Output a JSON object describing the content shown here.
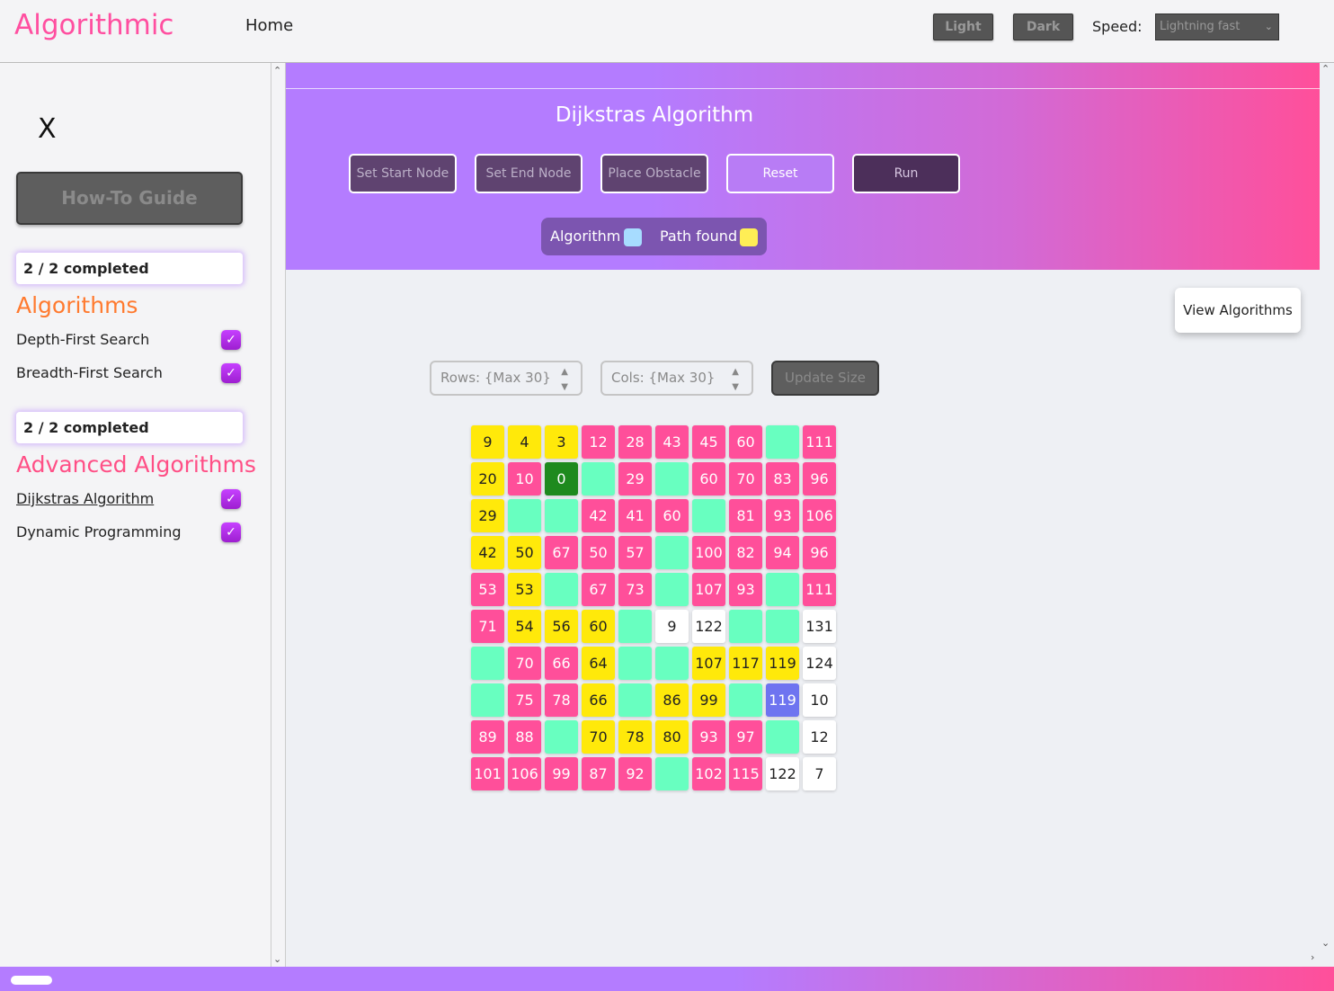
{
  "nav": {
    "brand": "Algorithmic",
    "home": "Home",
    "light": "Light",
    "dark": "Dark",
    "speed_label": "Speed:",
    "speed_value": "Lightning fast"
  },
  "sidebar": {
    "close": "X",
    "guide": "How-To Guide",
    "progress1": "2 / 2 completed",
    "section1": "Algorithms",
    "items1": [
      {
        "label": "Depth-First Search",
        "checked": true
      },
      {
        "label": "Breadth-First Search",
        "checked": true
      }
    ],
    "progress2": "2 / 2 completed",
    "section2": "Advanced Algorithms",
    "items2": [
      {
        "label": "Dijkstras Algorithm",
        "checked": true
      },
      {
        "label": "Dynamic Programming",
        "checked": true
      }
    ]
  },
  "header": {
    "title": "Dijkstras Algorithm",
    "buttons": [
      "Set Start Node",
      "Set End Node",
      "Place Obstacle",
      "Reset",
      "Run"
    ],
    "legend": [
      {
        "label": "Algorithm",
        "color": "#a7dcff"
      },
      {
        "label": "Path found",
        "color": "#ffee55"
      }
    ]
  },
  "controls": {
    "view_algorithms": "View Algorithms",
    "rows_placeholder": "Rows: {Max 30}",
    "cols_placeholder": "Cols: {Max 30}",
    "update": "Update Size"
  },
  "colors": {
    "visited": "#ff4f9a",
    "path": "#ffe90a",
    "obstacle": "#68ffc0",
    "start": "#1e8a1e",
    "unvisited": "#ffffff",
    "end": "#6e74f0"
  },
  "grid": [
    [
      [
        "9",
        "y"
      ],
      [
        "4",
        "y"
      ],
      [
        "3",
        "y"
      ],
      [
        "12",
        "p"
      ],
      [
        "28",
        "p"
      ],
      [
        "43",
        "p"
      ],
      [
        "45",
        "p"
      ],
      [
        "60",
        "p"
      ],
      [
        "",
        "t"
      ],
      [
        "111",
        "p"
      ]
    ],
    [
      [
        "20",
        "y"
      ],
      [
        "10",
        "p"
      ],
      [
        "0",
        "g"
      ],
      [
        "",
        "t"
      ],
      [
        "29",
        "p"
      ],
      [
        "",
        "t"
      ],
      [
        "60",
        "p"
      ],
      [
        "70",
        "p"
      ],
      [
        "83",
        "p"
      ],
      [
        "96",
        "p"
      ]
    ],
    [
      [
        "29",
        "y"
      ],
      [
        "",
        "t"
      ],
      [
        "",
        "t"
      ],
      [
        "42",
        "p"
      ],
      [
        "41",
        "p"
      ],
      [
        "60",
        "p"
      ],
      [
        "",
        "t"
      ],
      [
        "81",
        "p"
      ],
      [
        "93",
        "p"
      ],
      [
        "106",
        "p"
      ]
    ],
    [
      [
        "42",
        "y"
      ],
      [
        "50",
        "y"
      ],
      [
        "67",
        "p"
      ],
      [
        "50",
        "p"
      ],
      [
        "57",
        "p"
      ],
      [
        "",
        "t"
      ],
      [
        "100",
        "p"
      ],
      [
        "82",
        "p"
      ],
      [
        "94",
        "p"
      ],
      [
        "96",
        "p"
      ]
    ],
    [
      [
        "53",
        "p"
      ],
      [
        "53",
        "y"
      ],
      [
        "",
        "t"
      ],
      [
        "67",
        "p"
      ],
      [
        "73",
        "p"
      ],
      [
        "",
        "t"
      ],
      [
        "107",
        "p"
      ],
      [
        "93",
        "p"
      ],
      [
        "",
        "t"
      ],
      [
        "111",
        "p"
      ]
    ],
    [
      [
        "71",
        "p"
      ],
      [
        "54",
        "y"
      ],
      [
        "56",
        "y"
      ],
      [
        "60",
        "y"
      ],
      [
        "",
        "t"
      ],
      [
        "9",
        "w"
      ],
      [
        "122",
        "w"
      ],
      [
        "",
        "t"
      ],
      [
        "",
        "t"
      ],
      [
        "131",
        "w"
      ]
    ],
    [
      [
        "",
        "t"
      ],
      [
        "70",
        "p"
      ],
      [
        "66",
        "p"
      ],
      [
        "64",
        "y"
      ],
      [
        "",
        "t"
      ],
      [
        "",
        "t"
      ],
      [
        "107",
        "y"
      ],
      [
        "117",
        "y"
      ],
      [
        "119",
        "y"
      ],
      [
        "124",
        "w"
      ]
    ],
    [
      [
        "",
        "t"
      ],
      [
        "75",
        "p"
      ],
      [
        "78",
        "p"
      ],
      [
        "66",
        "y"
      ],
      [
        "",
        "t"
      ],
      [
        "86",
        "y"
      ],
      [
        "99",
        "y"
      ],
      [
        "",
        "t"
      ],
      [
        "119",
        "b"
      ],
      [
        "10",
        "w"
      ]
    ],
    [
      [
        "89",
        "p"
      ],
      [
        "88",
        "p"
      ],
      [
        "",
        "t"
      ],
      [
        "70",
        "y"
      ],
      [
        "78",
        "y"
      ],
      [
        "80",
        "y"
      ],
      [
        "93",
        "p"
      ],
      [
        "97",
        "p"
      ],
      [
        "",
        "t"
      ],
      [
        "12",
        "w"
      ]
    ],
    [
      [
        "101",
        "p"
      ],
      [
        "106",
        "p"
      ],
      [
        "99",
        "p"
      ],
      [
        "87",
        "p"
      ],
      [
        "92",
        "p"
      ],
      [
        "",
        "t"
      ],
      [
        "102",
        "p"
      ],
      [
        "115",
        "p"
      ],
      [
        "122",
        "w"
      ],
      [
        "7",
        "w"
      ]
    ]
  ]
}
